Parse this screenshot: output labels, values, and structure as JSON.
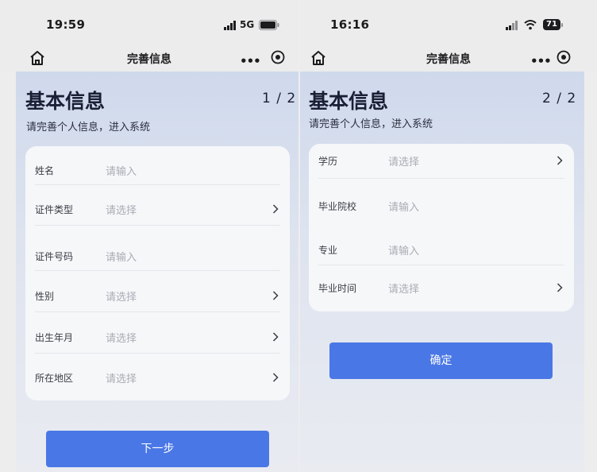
{
  "screens": [
    {
      "status": {
        "time": "19:59",
        "network": "5G"
      },
      "nav": {
        "title": "完善信息",
        "more": "•••"
      },
      "heading": "基本信息",
      "step": "1 / 2",
      "subtitle": "请完善个人信息，进入系统",
      "fields": [
        {
          "label": "姓名",
          "placeholder": "请输入"
        },
        {
          "label": "证件类型",
          "placeholder": "请选择"
        },
        {
          "label": "证件号码",
          "placeholder": "请输入"
        },
        {
          "label": "性别",
          "placeholder": "请选择"
        },
        {
          "label": "出生年月",
          "placeholder": "请选择"
        },
        {
          "label": "所在地区",
          "placeholder": "请选择"
        }
      ],
      "button": "下一步"
    },
    {
      "status": {
        "time": "16:16",
        "battery": "71"
      },
      "nav": {
        "title": "完善信息",
        "more": "•••"
      },
      "heading": "基本信息",
      "step": "2 / 2",
      "subtitle": "请完善个人信息，进入系统",
      "fields": [
        {
          "label": "学历",
          "placeholder": "请选择"
        },
        {
          "label": "毕业院校",
          "placeholder": "请输入"
        },
        {
          "label": "专业",
          "placeholder": "请输入"
        },
        {
          "label": "毕业时间",
          "placeholder": "请选择"
        }
      ],
      "button": "确定"
    }
  ],
  "colors": {
    "accent": "#4a77e6",
    "placeholder": "#a9acb4"
  },
  "icons": [
    "home-icon",
    "more-icon",
    "target-icon",
    "chevron-right-icon",
    "signal-icon",
    "wifi-icon",
    "battery-icon"
  ]
}
